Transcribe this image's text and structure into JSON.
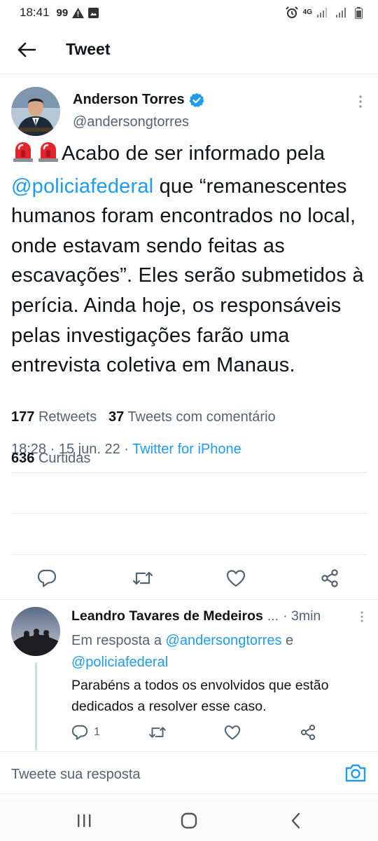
{
  "status_bar": {
    "time": "18:41",
    "notification_badge": "99",
    "network_label": "4G"
  },
  "header": {
    "title": "Tweet"
  },
  "tweet": {
    "author_name": "Anderson Torres",
    "author_handle": "@andersongtorres",
    "text_part1": "Acabo de ser informado pela",
    "mention": "@policiafederal",
    "text_part2": " que “remanescentes humanos foram encontrados no local, onde estavam sendo feitas as escavações”. Eles serão submetidos à perícia. Ainda hoje, os responsáveis pelas investigações farão uma entrevista coletiva em Manaus.",
    "time": "18:28",
    "date": "15 jun. 22",
    "source": "Twitter for iPhone",
    "retweets_count": "177",
    "retweets_label": "Retweets",
    "quote_count": "37",
    "quote_label": "Tweets com comentário",
    "likes_count": "636",
    "likes_label": "Curtidas"
  },
  "reply": {
    "author_name": "Leandro Tavares de Medeiros",
    "ellipsis": "...",
    "time": "3min",
    "reply_to_label": "Em resposta a",
    "reply_to_user1": "@andersongtorres",
    "reply_to_conj": "e",
    "reply_to_user2": "@policiafederal",
    "text": "Parabéns a todos os envolvidos que estão dedicados a resolver esse caso.",
    "reply_count": "1"
  },
  "compose": {
    "placeholder": "Tweete sua resposta"
  },
  "colors": {
    "accent": "#1d9bf0",
    "secondary_text": "#536471",
    "verified": "#1d9bf0"
  },
  "icons": [
    "back-arrow-icon",
    "verified-badge-icon",
    "more-vertical-icon",
    "siren-icon",
    "reply-icon",
    "retweet-icon",
    "like-icon",
    "share-icon",
    "camera-icon",
    "recent-apps-icon",
    "home-icon",
    "back-nav-icon"
  ]
}
